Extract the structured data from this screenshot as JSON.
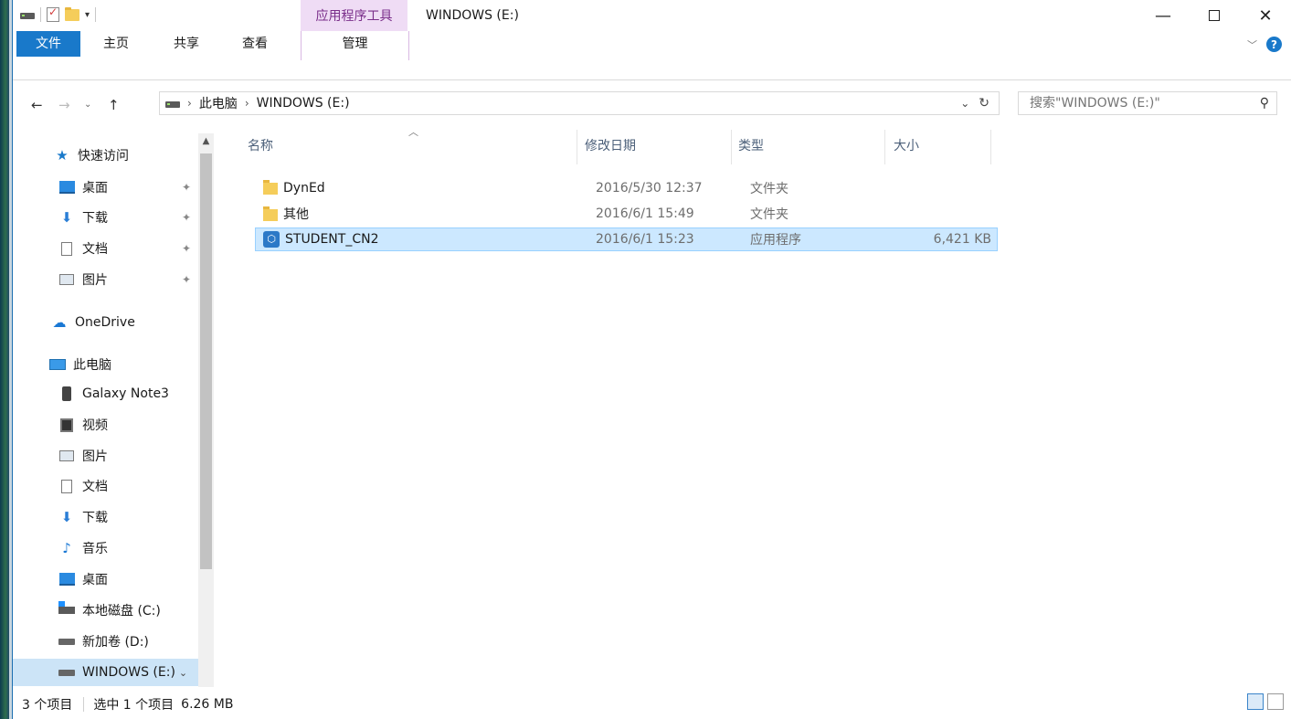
{
  "titlebar": {
    "context_tab": "应用程序工具",
    "title": "WINDOWS (E:)",
    "minimize": "—",
    "close": "✕"
  },
  "ribbon": {
    "tabs": [
      "文件",
      "主页",
      "共享",
      "查看",
      "管理"
    ],
    "accent": "#1979ca",
    "context_color": "#efdcf5"
  },
  "address": {
    "crumbs": [
      "此电脑",
      "WINDOWS (E:)"
    ],
    "search_placeholder": "搜索\"WINDOWS (E:)\""
  },
  "sidebar": {
    "items": [
      {
        "label": "快速访问",
        "icon": "star-icon",
        "pinned": false
      },
      {
        "label": "桌面",
        "icon": "desktop-icon",
        "pinned": true
      },
      {
        "label": "下载",
        "icon": "download-icon",
        "pinned": true
      },
      {
        "label": "文档",
        "icon": "document-icon",
        "pinned": true
      },
      {
        "label": "图片",
        "icon": "picture-icon",
        "pinned": true
      },
      {
        "label": "OneDrive",
        "icon": "cloud-icon",
        "pinned": false
      },
      {
        "label": "此电脑",
        "icon": "computer-icon",
        "pinned": false
      },
      {
        "label": "Galaxy Note3",
        "icon": "phone-icon",
        "pinned": false
      },
      {
        "label": "视频",
        "icon": "video-icon",
        "pinned": false
      },
      {
        "label": "图片",
        "icon": "picture-icon",
        "pinned": false
      },
      {
        "label": "文档",
        "icon": "document-icon",
        "pinned": false
      },
      {
        "label": "下载",
        "icon": "download-icon",
        "pinned": false
      },
      {
        "label": "音乐",
        "icon": "music-icon",
        "pinned": false
      },
      {
        "label": "桌面",
        "icon": "desktop-icon",
        "pinned": false
      },
      {
        "label": "本地磁盘 (C:)",
        "icon": "system-drive-icon",
        "pinned": false
      },
      {
        "label": "新加卷 (D:)",
        "icon": "drive-icon",
        "pinned": false
      },
      {
        "label": "WINDOWS (E:)",
        "icon": "drive-icon",
        "pinned": false,
        "selected": true
      }
    ]
  },
  "columns": {
    "name": "名称",
    "date": "修改日期",
    "type": "类型",
    "size": "大小"
  },
  "files": [
    {
      "name": "DynEd",
      "date": "2016/5/30 12:37",
      "type": "文件夹",
      "size": "",
      "icon": "folder-icon"
    },
    {
      "name": "其他",
      "date": "2016/6/1 15:49",
      "type": "文件夹",
      "size": "",
      "icon": "folder-icon"
    },
    {
      "name": "STUDENT_CN2",
      "date": "2016/6/1 15:23",
      "type": "应用程序",
      "size": "6,421 KB",
      "icon": "application-icon",
      "selected": true
    }
  ],
  "status": {
    "count": "3 个项目",
    "selection": "选中 1 个项目",
    "size": "6.26 MB"
  }
}
